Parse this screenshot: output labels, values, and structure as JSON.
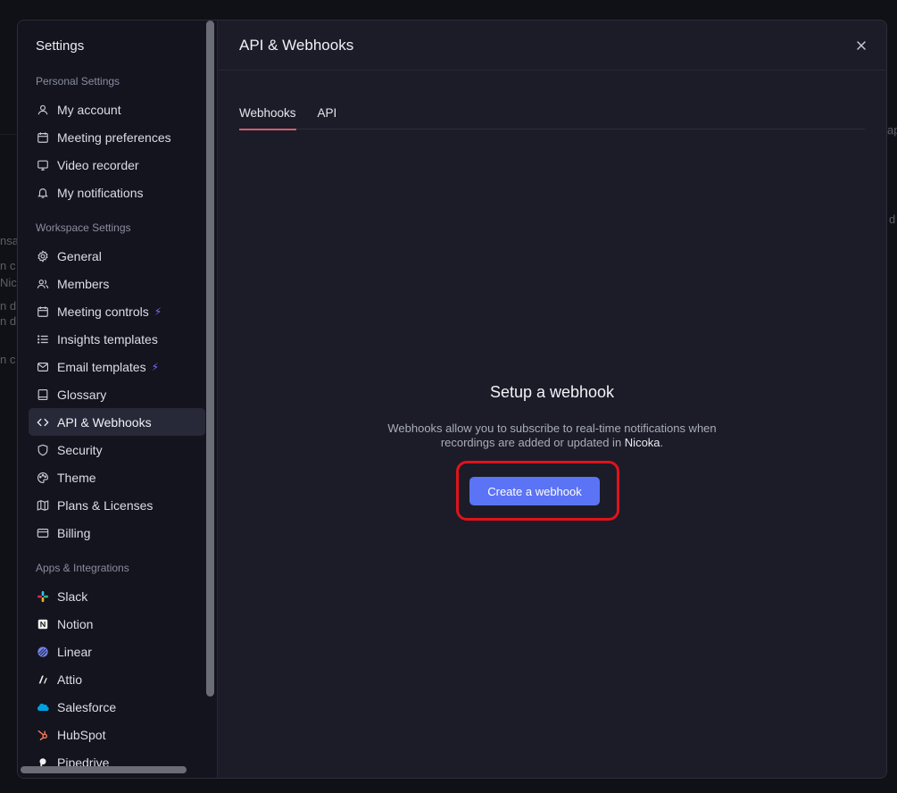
{
  "background": {
    "fragments": [
      "nsa",
      "n c",
      "Nic",
      "n du",
      "n du",
      "n c",
      "ap",
      "d"
    ]
  },
  "sidebar": {
    "title": "Settings",
    "sections": [
      {
        "label": "Personal Settings",
        "items": [
          {
            "label": "My account",
            "icon": "user-icon"
          },
          {
            "label": "Meeting preferences",
            "icon": "calendar-icon"
          },
          {
            "label": "Video recorder",
            "icon": "monitor-icon"
          },
          {
            "label": "My notifications",
            "icon": "bell-icon"
          }
        ]
      },
      {
        "label": "Workspace Settings",
        "items": [
          {
            "label": "General",
            "icon": "gear-icon"
          },
          {
            "label": "Members",
            "icon": "users-icon"
          },
          {
            "label": "Meeting controls",
            "icon": "calendar-icon"
          },
          {
            "label": "Insights templates",
            "icon": "list-icon"
          },
          {
            "label": "Email templates",
            "icon": "mail-icon"
          },
          {
            "label": "Glossary",
            "icon": "book-icon"
          },
          {
            "label": "API & Webhooks",
            "icon": "code-icon"
          },
          {
            "label": "Security",
            "icon": "shield-icon"
          },
          {
            "label": "Theme",
            "icon": "palette-icon"
          },
          {
            "label": "Plans & Licenses",
            "icon": "map-icon"
          },
          {
            "label": "Billing",
            "icon": "credit-card-icon"
          }
        ]
      },
      {
        "label": "Apps & Integrations",
        "items": [
          {
            "label": "Slack",
            "icon": "slack-icon"
          },
          {
            "label": "Notion",
            "icon": "notion-icon"
          },
          {
            "label": "Linear",
            "icon": "linear-icon"
          },
          {
            "label": "Attio",
            "icon": "attio-icon"
          },
          {
            "label": "Salesforce",
            "icon": "salesforce-icon"
          },
          {
            "label": "HubSpot",
            "icon": "hubspot-icon"
          },
          {
            "label": "Pipedrive",
            "icon": "pipedrive-icon"
          }
        ]
      }
    ]
  },
  "main": {
    "title": "API & Webhooks",
    "tabs": [
      {
        "label": "Webhooks"
      },
      {
        "label": "API"
      }
    ],
    "empty_state": {
      "title": "Setup a webhook",
      "description_line1": "Webhooks allow you to subscribe to real-time notifications when",
      "description_line2_prefix": "recordings are added or updated in ",
      "brand": "Nicoka",
      "description_line2_suffix": ".",
      "button_label": "Create a webhook"
    }
  },
  "colors": {
    "accent": "#5b73f5",
    "tab_underline": "#d65b6c",
    "highlight": "#e1121b",
    "bolt": "#7c6cf5"
  }
}
